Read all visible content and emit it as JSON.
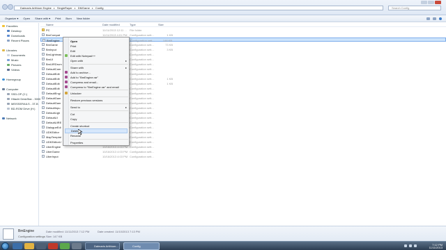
{
  "address": {
    "crumbs": [
      "Dalmaris Arithium Engine",
      "SingleRayer",
      "DMGame",
      "Config"
    ],
    "search_placeholder": "Search Config"
  },
  "toolbar": {
    "organize": "Organize ▾",
    "open": "Open",
    "share_with": "Share with ▾",
    "print": "Print",
    "burn": "Burn",
    "new_folder": "New folder"
  },
  "nav": {
    "favorites": "Favorites",
    "desktop": "Desktop",
    "downloads": "Downloads",
    "recent": "Recent Places",
    "libraries": "Libraries",
    "documents": "Documents",
    "music": "Music",
    "pictures": "Pictures",
    "videos": "Videos",
    "homegroup": "Homegroup",
    "computer": "Computer",
    "drive1": "SSD-OP (C:)",
    "drive2": "Hitachi DeskStar - 3000",
    "drive3": "MEISSERAILS - 3T-B",
    "drive4": "BD-ROM Drive (H:)",
    "network": "Network"
  },
  "columns": {
    "name": "Name",
    "date": "Date modified",
    "type": "Type",
    "size": "Size"
  },
  "files": [
    {
      "name": "PC",
      "date": "11/11/2013 12:11 ...",
      "type": "File folder",
      "size": "",
      "folder": true
    },
    {
      "name": "BmCompat",
      "date": "11/11/2013 4:01 PM",
      "type": "Configuration sett...",
      "size": "1 KB",
      "folder": false
    },
    {
      "name": "BmEngine",
      "date": "11/11/2013 7:12 PM",
      "type": "Configuration sett...",
      "size": "148 KB",
      "folder": false,
      "selected": true
    },
    {
      "name": "BmGame",
      "date": "",
      "type": "Configuration sett...",
      "size": "73 KB",
      "folder": false
    },
    {
      "name": "BmInput",
      "date": "",
      "type": "Configuration sett...",
      "size": "3 KB",
      "folder": false
    },
    {
      "name": "BmLightmas",
      "date": "",
      "type": "Configuration sett...",
      "size": "",
      "folder": false
    },
    {
      "name": "BmUI",
      "date": "",
      "type": "Configuration sett...",
      "size": "",
      "folder": false
    },
    {
      "name": "BmUIRDrum",
      "date": "",
      "type": "Configuration sett...",
      "size": "",
      "folder": false
    },
    {
      "name": "DefaultCam",
      "date": "",
      "type": "Configuration sett...",
      "size": "",
      "folder": false
    },
    {
      "name": "DefaultEdit",
      "date": "",
      "type": "Configuration sett...",
      "size": "",
      "folder": false
    },
    {
      "name": "DefaultEdit",
      "date": "",
      "type": "Configuration sett...",
      "size": "1 KB",
      "folder": false
    },
    {
      "name": "DefaultEdit",
      "date": "",
      "type": "Configuration sett...",
      "size": "1 KB",
      "folder": false
    },
    {
      "name": "DefaultEdit",
      "date": "",
      "type": "Configuration sett...",
      "size": "",
      "folder": false
    },
    {
      "name": "DefaultEngi",
      "date": "",
      "type": "Configuration sett...",
      "size": "",
      "folder": false
    },
    {
      "name": "DefaultGam",
      "date": "",
      "type": "Configuration sett...",
      "size": "",
      "folder": false
    },
    {
      "name": "DefaultGam",
      "date": "",
      "type": "Configuration sett...",
      "size": "",
      "folder": false
    },
    {
      "name": "DefaultInpu",
      "date": "",
      "type": "Configuration sett...",
      "size": "",
      "folder": false
    },
    {
      "name": "DefaultLigh",
      "date": "",
      "type": "Configuration sett...",
      "size": "",
      "folder": false
    },
    {
      "name": "DefaultUI",
      "date": "",
      "type": "Configuration sett...",
      "size": "",
      "folder": false
    },
    {
      "name": "DefaultUIRE",
      "date": "",
      "type": "Configuration sett...",
      "size": "",
      "folder": false
    },
    {
      "name": "DialogueEdi",
      "date": "",
      "type": "Configuration sett...",
      "size": "",
      "folder": false
    },
    {
      "name": "UDKEditor",
      "date": "",
      "type": "Configuration sett...",
      "size": "",
      "folder": false
    },
    {
      "name": "MapTemplat",
      "date": "",
      "type": "Configuration sett...",
      "size": "",
      "folder": false
    },
    {
      "name": "UDKEditorU",
      "date": "",
      "type": "Configuration sett...",
      "size": "",
      "folder": false
    },
    {
      "name": "UberEngine",
      "date": "10/16/2013 4:03 PM",
      "type": "Configuration sett...",
      "size": "",
      "folder": false
    },
    {
      "name": "UberGame",
      "date": "10/16/2013 4:03 PM",
      "type": "Configuration sett...",
      "size": "",
      "folder": false
    },
    {
      "name": "UberInput",
      "date": "10/16/2013 4:03 PM",
      "type": "Configuration sett...",
      "size": "",
      "folder": false
    }
  ],
  "context_menu": {
    "open": "Open",
    "print": "Print",
    "edit": "Edit",
    "edit_notepad": "Edit with Notepad++",
    "open_with": "Open with",
    "share_with": "Share with",
    "add_archive": "Add to archive...",
    "add_rar": "Add to \"BmEngine.rar\"",
    "compress_email": "Compress and email...",
    "compress_rar_email": "Compress to \"BmEngine.rar\" and email",
    "unlocker": "Unlocker",
    "restore": "Restore previous versions",
    "send_to": "Send to",
    "cut": "Cut",
    "copy": "Copy",
    "create_shortcut": "Create shortcut",
    "delete": "Delete",
    "rename": "Rename",
    "properties": "Properties"
  },
  "details": {
    "name": "BmEngine",
    "type": "Configuration settings",
    "date_modified_label": "Date modified: 11/11/2013 7:12 PM",
    "date_created_label": "Date created: 11/10/2013 7:13 PM",
    "size_label": "Size: 147 KB"
  },
  "taskbar": {
    "task1": "Dalmaris Arithium...",
    "task2": "Config",
    "time": "7:12 PM",
    "date": "11/11/2013"
  },
  "colors": {
    "selection": "#cde4fb",
    "menu_highlight": "#d6e7fb",
    "taskbar": "#2c3d52"
  }
}
